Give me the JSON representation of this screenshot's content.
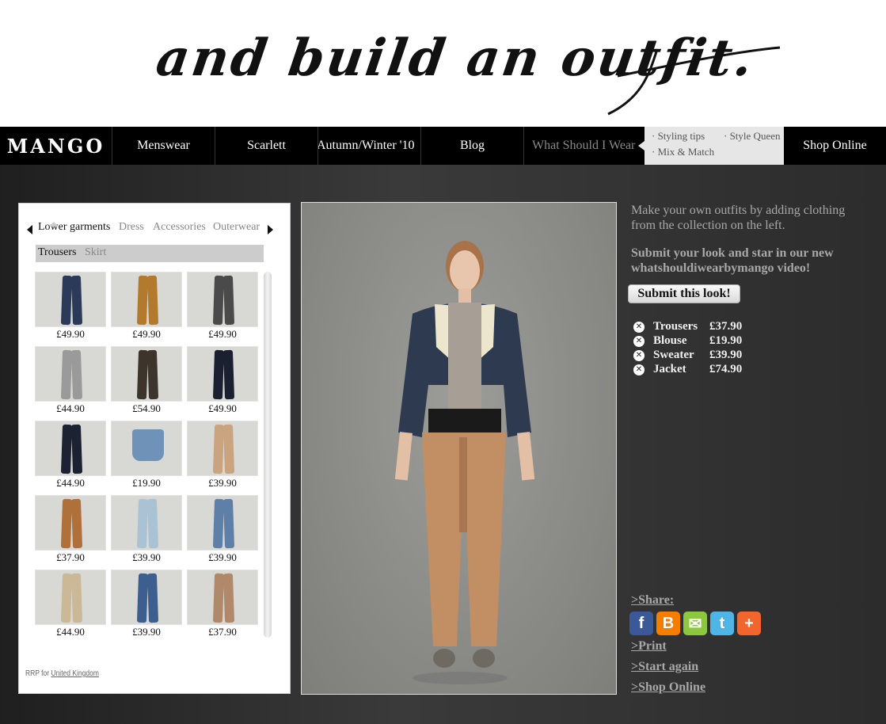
{
  "hero": {
    "script_text": "and build an outfit."
  },
  "nav": {
    "logo": "MANGO",
    "items": [
      "Menswear",
      "Scarlett",
      "Autumn/Winter '10",
      "Blog",
      "What Should I Wear"
    ],
    "subnav": [
      "· Styling tips",
      "· Style Queen",
      "· Mix & Match"
    ],
    "shop": "Shop Online"
  },
  "panel": {
    "categories": [
      "Lower garments",
      "Dress",
      "Accessories",
      "Outerwear"
    ],
    "active_category": "Lower garments",
    "subcategories": [
      "Trousers",
      "Skirt"
    ],
    "active_subcategory": "Trousers",
    "products": [
      {
        "price": "£49.90",
        "color": "#2c3a5a",
        "kind": "trousers"
      },
      {
        "price": "£49.90",
        "color": "#b37a2e",
        "kind": "trousers"
      },
      {
        "price": "£49.90",
        "color": "#4a4a4a",
        "kind": "trousers"
      },
      {
        "price": "£44.90",
        "color": "#9a9a9a",
        "kind": "trousers"
      },
      {
        "price": "£54.90",
        "color": "#3d342b",
        "kind": "trousers"
      },
      {
        "price": "£49.90",
        "color": "#1b2030",
        "kind": "trousers"
      },
      {
        "price": "£44.90",
        "color": "#1d2233",
        "kind": "trousers"
      },
      {
        "price": "£19.90",
        "color": "#6f93b8",
        "kind": "shorts"
      },
      {
        "price": "£39.90",
        "color": "#c9a47e",
        "kind": "trousers"
      },
      {
        "price": "£37.90",
        "color": "#b0703a",
        "kind": "trousers"
      },
      {
        "price": "£39.90",
        "color": "#a9c2d4",
        "kind": "trousers"
      },
      {
        "price": "£39.90",
        "color": "#5e7fa8",
        "kind": "trousers"
      },
      {
        "price": "£44.90",
        "color": "#cbb896",
        "kind": "trousers"
      },
      {
        "price": "£39.90",
        "color": "#3c5f90",
        "kind": "trousers"
      },
      {
        "price": "£37.90",
        "color": "#b0896a",
        "kind": "trousers"
      }
    ],
    "rrp_prefix": "RRP for",
    "rrp_link": "United Kingdom"
  },
  "right": {
    "intro": "Make your own outfits by adding clothing from the collection on the left.",
    "intro_bold": "Submit your look and star in our new whatshouldiwearbymango video!",
    "submit": "Submit this look!",
    "outfit": [
      {
        "name": "Trousers",
        "price": "£37.90"
      },
      {
        "name": "Blouse",
        "price": "£19.90"
      },
      {
        "name": "Sweater",
        "price": "£39.90"
      },
      {
        "name": "Jacket",
        "price": "£74.90"
      }
    ],
    "share": ">Share:",
    "share_icons": [
      {
        "name": "facebook-icon",
        "glyph": "f",
        "color": "#3b5998"
      },
      {
        "name": "blogger-icon",
        "glyph": "B",
        "color": "#f57d00"
      },
      {
        "name": "email-icon",
        "glyph": "✉",
        "color": "#8dc63f"
      },
      {
        "name": "twitter-icon",
        "glyph": "t",
        "color": "#4fb4e6"
      },
      {
        "name": "addthis-icon",
        "glyph": "+",
        "color": "#f2652c"
      }
    ],
    "print": ">Print",
    "start_again": ">Start again",
    "shop_online": ">Shop Online"
  }
}
